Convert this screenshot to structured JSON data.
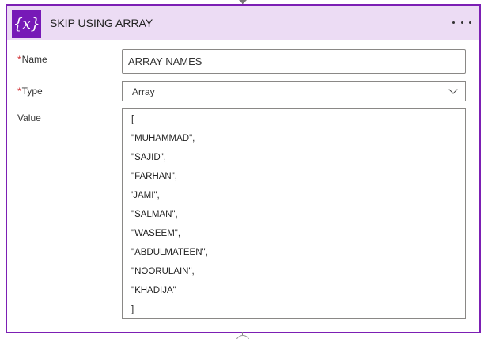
{
  "card": {
    "title": "SKIP USING ARRAY",
    "icon": "variable-icon",
    "icon_glyph": "{x}",
    "accent_color": "#7719b7",
    "header_bg": "#ecdcf4"
  },
  "fields": {
    "name": {
      "label": "Name",
      "required_mark": "*",
      "value": "ARRAY NAMES"
    },
    "type": {
      "label": "Type",
      "required_mark": "*",
      "selected": "Array"
    },
    "value": {
      "label": "Value",
      "lines": [
        "[",
        "\"MUHAMMAD\",",
        "\"SAJID\",",
        "\"FARHAN\",",
        "'JAMI\",",
        "\"SALMAN\",",
        "\"WASEEM\",",
        "\"ABDULMATEEN\",",
        "\"NOORULAIN\",",
        "\"KHADIJA\"",
        "]"
      ]
    }
  }
}
